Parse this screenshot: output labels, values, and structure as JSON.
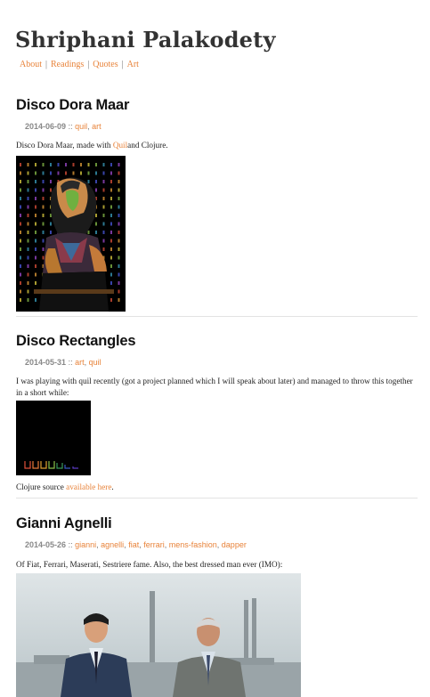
{
  "site": {
    "title": "Shriphani Palakodety"
  },
  "nav": [
    {
      "label": "About"
    },
    {
      "label": "Readings"
    },
    {
      "label": "Quotes"
    },
    {
      "label": "Art"
    }
  ],
  "posts": [
    {
      "title": "Disco Dora Maar",
      "date": "2014-06-09",
      "sep": "::",
      "tags": [
        "quil",
        "art"
      ],
      "text_before": "Disco Dora Maar, made with ",
      "link_text": "Quil",
      "text_after": "and Clojure."
    },
    {
      "title": "Disco Rectangles",
      "date": "2014-05-31",
      "sep": "::",
      "tags": [
        "art",
        "quil"
      ],
      "text": "I was playing with quil recently (got a project planned which I will speak about later) and managed to throw this together in a short while:",
      "footer_before": "Clojure source ",
      "footer_link": "available here",
      "footer_after": "."
    },
    {
      "title": "Gianni Agnelli",
      "date": "2014-05-26",
      "sep": "::",
      "tags": [
        "gianni",
        "agnelli",
        "fiat",
        "ferrari",
        "mens-fashion",
        "dapper"
      ],
      "text": "Of Fiat, Ferrari, Maserati, Sestriere fame. Also, the best dressed man ever (IMO):"
    }
  ]
}
